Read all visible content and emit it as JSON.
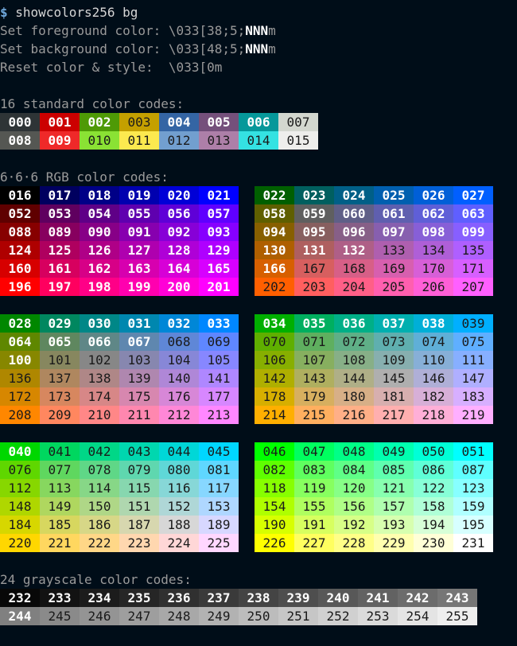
{
  "terminal": {
    "prompt_symbol": "$",
    "command": " showcolors256 bg",
    "fg_line_prefix": "Set foreground color: \\033[38;5;",
    "bg_line_prefix": "Set background color: \\033[48;5;",
    "placeholder": "NNN",
    "suffix": "m",
    "reset_line": "Reset color & style:  \\033[0m",
    "heading_standard": "16 standard color codes:",
    "heading_rgb": "6·6·6 RGB color codes:",
    "heading_gray": "24 grayscale color codes:"
  },
  "colors": {
    "background": "#000d18",
    "text": "#d6d6d6",
    "prompt": "#6fa8dc",
    "standard_palette": [
      "#2e3436",
      "#cc0000",
      "#4e9a06",
      "#c4a000",
      "#3465a4",
      "#75507b",
      "#06989a",
      "#d3d7cf",
      "#555753",
      "#ef2929",
      "#8ae234",
      "#fce94f",
      "#729fcf",
      "#ad7fa8",
      "#34e2e2",
      "#eeeeec"
    ]
  },
  "cells": [
    "000",
    "001",
    "002",
    "003",
    "004",
    "005",
    "006",
    "007",
    "008",
    "009",
    "010",
    "011",
    "012",
    "013",
    "014",
    "015",
    "016",
    "017",
    "018",
    "019",
    "020",
    "021",
    "022",
    "023",
    "024",
    "025",
    "026",
    "027",
    "028",
    "029",
    "030",
    "031",
    "032",
    "033",
    "034",
    "035",
    "036",
    "037",
    "038",
    "039",
    "040",
    "041",
    "042",
    "043",
    "044",
    "045",
    "046",
    "047",
    "048",
    "049",
    "050",
    "051",
    "052",
    "053",
    "054",
    "055",
    "056",
    "057",
    "058",
    "059",
    "060",
    "061",
    "062",
    "063",
    "064",
    "065",
    "066",
    "067",
    "068",
    "069",
    "070",
    "071",
    "072",
    "073",
    "074",
    "075",
    "076",
    "077",
    "078",
    "079",
    "080",
    "081",
    "082",
    "083",
    "084",
    "085",
    "086",
    "087",
    "088",
    "089",
    "090",
    "091",
    "092",
    "093",
    "094",
    "095",
    "096",
    "097",
    "098",
    "099",
    "100",
    "101",
    "102",
    "103",
    "104",
    "105",
    "106",
    "107",
    "108",
    "109",
    "110",
    "111",
    "112",
    "113",
    "114",
    "115",
    "116",
    "117",
    "118",
    "119",
    "120",
    "121",
    "122",
    "123",
    "124",
    "125",
    "126",
    "127",
    "128",
    "129",
    "130",
    "131",
    "132",
    "133",
    "134",
    "135",
    "136",
    "137",
    "138",
    "139",
    "140",
    "141",
    "142",
    "143",
    "144",
    "145",
    "146",
    "147",
    "148",
    "149",
    "150",
    "151",
    "152",
    "153",
    "154",
    "155",
    "156",
    "157",
    "158",
    "159",
    "160",
    "161",
    "162",
    "163",
    "164",
    "165",
    "166",
    "167",
    "168",
    "169",
    "170",
    "171",
    "172",
    "173",
    "174",
    "175",
    "176",
    "177",
    "178",
    "179",
    "180",
    "181",
    "182",
    "183",
    "184",
    "185",
    "186",
    "187",
    "188",
    "189",
    "190",
    "191",
    "192",
    "193",
    "194",
    "195",
    "196",
    "197",
    "198",
    "199",
    "200",
    "201",
    "202",
    "203",
    "204",
    "205",
    "206",
    "207",
    "208",
    "209",
    "210",
    "211",
    "212",
    "213",
    "214",
    "215",
    "216",
    "217",
    "218",
    "219",
    "220",
    "221",
    "222",
    "223",
    "224",
    "225",
    "226",
    "227",
    "228",
    "229",
    "230",
    "231",
    "232",
    "233",
    "234",
    "235",
    "236",
    "237",
    "238",
    "239",
    "240",
    "241",
    "242",
    "243",
    "244",
    "245",
    "246",
    "247",
    "248",
    "249",
    "250",
    "251",
    "252",
    "253",
    "254",
    "255"
  ]
}
